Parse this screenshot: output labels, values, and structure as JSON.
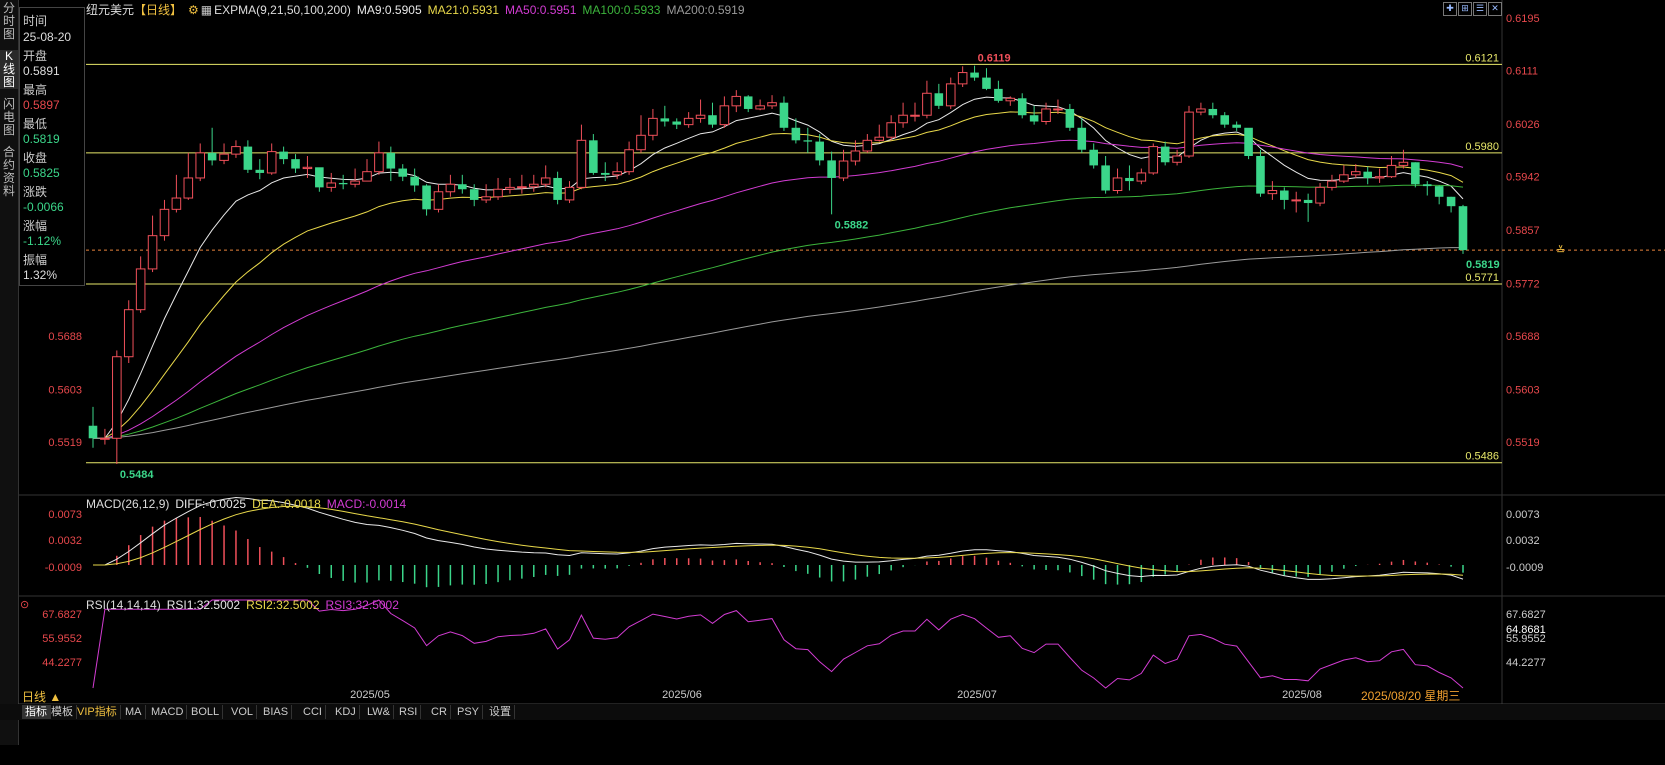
{
  "nav": {
    "items": [
      "分\n时\n图",
      "K\n线\n图",
      "闪\n电\n图",
      "合\n约\n资\n料"
    ],
    "active_index": 1
  },
  "info": {
    "time_label": "时间",
    "time_value": "25-08-20",
    "open_label": "开盘",
    "open_value": "0.5891",
    "high_label": "最高",
    "high_value": "0.5897",
    "low_label": "最低",
    "low_value": "0.5819",
    "close_label": "收盘",
    "close_value": "0.5825",
    "change_label": "涨跌",
    "change_value": "-0.0066",
    "pct_label": "涨幅",
    "pct_value": "-1.12%",
    "amp_label": "振幅",
    "amp_value": "1.32%"
  },
  "title": {
    "symbol": "纽元美元",
    "period": "【日线】",
    "indicator": "EXPMA(9,21,50,100,200)",
    "ma9": "MA9:0.5905",
    "ma21": "MA21:0.5931",
    "ma50": "MA50:0.5951",
    "ma100": "MA100:0.5933",
    "ma200": "MA200:0.5919"
  },
  "colors": {
    "up": "#f0505a",
    "down": "#3bd68a",
    "ma9": "#e8e8e8",
    "ma21": "#e8d84a",
    "ma50": "#d23cd2",
    "ma100": "#3cb43c",
    "ma200": "#9a9a9a",
    "hline": "#e8e86a",
    "axis_red": "#e8484c"
  },
  "main_axis": {
    "ticks": [
      "0.6195",
      "0.6111",
      "0.6026",
      "0.5942",
      "0.5857",
      "0.5772",
      "0.5688",
      "0.5603",
      "0.5519"
    ],
    "left_ticks": [
      "0.5688",
      "0.5603",
      "0.5519"
    ],
    "hlines": [
      "0.6121",
      "0.5980",
      "0.5771",
      "0.5486"
    ],
    "current": "0.5825",
    "high_mark": "0.6119",
    "low_mark": "0.5484",
    "mid_low_mark": "0.5882",
    "last_low_mark": "0.5819"
  },
  "macd": {
    "title": "MACD(26,12,9)",
    "diff": "DIFF:-0.0025",
    "dea": "DEA:-0.0018",
    "macd": "MACD:-0.0014",
    "ticks": [
      "0.0073",
      "0.0032",
      "-0.0009"
    ]
  },
  "rsi": {
    "title": "RSI(14,14,14)",
    "rsi1": "RSI1:32.5002",
    "rsi2": "RSI2:32.5002",
    "rsi3": "RSI3:32.5002",
    "ticks": [
      "67.6827",
      "55.9552",
      "44.2277"
    ],
    "right_ticks": [
      "67.6827",
      "64.8681",
      "55.9552",
      "44.2277"
    ]
  },
  "dates": [
    "2025/05",
    "2025/06",
    "2025/07",
    "2025/08"
  ],
  "date_box": "2025/08/20 星期三",
  "period_button": "日线 ▲",
  "tabs": [
    "指标",
    "模板",
    "VIP指标",
    "MA",
    "MACD",
    "BOLL",
    "VOL",
    "BIAS",
    "CCI",
    "KDJ",
    "LW&",
    "RSI",
    "CR",
    "PSY",
    "设置"
  ],
  "chart_data": {
    "type": "candlestick",
    "title": "纽元美元",
    "ylim": [
      0.5476,
      0.6195
    ],
    "open": [
      0.5545,
      0.5525,
      0.5525,
      0.5655,
      0.573,
      0.5795,
      0.5848,
      0.589,
      0.5908,
      0.594,
      0.598,
      0.5968,
      0.5978,
      0.599,
      0.5953,
      0.5948,
      0.5982,
      0.597,
      0.5955,
      0.5957,
      0.5925,
      0.5932,
      0.593,
      0.5935,
      0.595,
      0.598,
      0.5955,
      0.5942,
      0.5928,
      0.589,
      0.5918,
      0.593,
      0.5922,
      0.5905,
      0.591,
      0.5922,
      0.5925,
      0.5926,
      0.593,
      0.594,
      0.5905,
      0.5925,
      0.6,
      0.5948,
      0.5945,
      0.595,
      0.5985,
      0.6008,
      0.6035,
      0.603,
      0.6025,
      0.6035,
      0.604,
      0.6025,
      0.6055,
      0.607,
      0.605,
      0.6055,
      0.606,
      0.602,
      0.6,
      0.5998,
      0.5968,
      0.594,
      0.5967,
      0.5983,
      0.6,
      0.6005,
      0.6028,
      0.604,
      0.604,
      0.6075,
      0.6055,
      0.609,
      0.6108,
      0.61,
      0.6082,
      0.6063,
      0.6067,
      0.604,
      0.603,
      0.605,
      0.605,
      0.602,
      0.5985,
      0.596,
      0.592,
      0.594,
      0.5935,
      0.5948,
      0.599,
      0.5965,
      0.5975,
      0.6045,
      0.605,
      0.604,
      0.6025,
      0.602,
      0.5975,
      0.5915,
      0.592,
      0.5905,
      0.5905,
      0.59,
      0.5925,
      0.5935,
      0.5945,
      0.595,
      0.594,
      0.5942,
      0.596,
      0.5965,
      0.593,
      0.5927,
      0.591,
      0.5895
    ],
    "close": [
      0.5525,
      0.5525,
      0.5655,
      0.573,
      0.5795,
      0.5848,
      0.589,
      0.5908,
      0.594,
      0.598,
      0.5968,
      0.5978,
      0.599,
      0.5953,
      0.5948,
      0.5982,
      0.597,
      0.5955,
      0.5957,
      0.5925,
      0.5932,
      0.593,
      0.5935,
      0.595,
      0.598,
      0.5955,
      0.5942,
      0.5928,
      0.589,
      0.5918,
      0.593,
      0.5922,
      0.5905,
      0.591,
      0.5922,
      0.5925,
      0.5926,
      0.593,
      0.594,
      0.5905,
      0.5925,
      0.6,
      0.5948,
      0.5945,
      0.595,
      0.5985,
      0.6008,
      0.6035,
      0.603,
      0.6025,
      0.6035,
      0.604,
      0.6025,
      0.6055,
      0.607,
      0.605,
      0.6055,
      0.606,
      0.602,
      0.6,
      0.5998,
      0.5968,
      0.594,
      0.5967,
      0.5983,
      0.6,
      0.6005,
      0.6028,
      0.604,
      0.604,
      0.6075,
      0.6055,
      0.609,
      0.6108,
      0.61,
      0.6082,
      0.6063,
      0.6067,
      0.604,
      0.603,
      0.605,
      0.605,
      0.602,
      0.5985,
      0.596,
      0.592,
      0.594,
      0.5935,
      0.5948,
      0.599,
      0.5965,
      0.5975,
      0.6045,
      0.605,
      0.604,
      0.6025,
      0.602,
      0.5975,
      0.5915,
      0.592,
      0.5905,
      0.5905,
      0.59,
      0.5925,
      0.5935,
      0.5945,
      0.595,
      0.594,
      0.5942,
      0.596,
      0.5965,
      0.593,
      0.5927,
      0.591,
      0.5895,
      0.5825
    ],
    "high": [
      0.5575,
      0.554,
      0.5665,
      0.5745,
      0.5815,
      0.588,
      0.5905,
      0.5945,
      0.598,
      0.5995,
      0.602,
      0.5995,
      0.6,
      0.6,
      0.597,
      0.5995,
      0.599,
      0.5978,
      0.5975,
      0.595,
      0.5948,
      0.5945,
      0.5955,
      0.597,
      0.5998,
      0.599,
      0.5962,
      0.5955,
      0.593,
      0.593,
      0.5945,
      0.5945,
      0.593,
      0.593,
      0.594,
      0.594,
      0.5945,
      0.5945,
      0.596,
      0.595,
      0.5935,
      0.6025,
      0.601,
      0.5965,
      0.5965,
      0.5998,
      0.604,
      0.605,
      0.6055,
      0.6035,
      0.6045,
      0.6065,
      0.606,
      0.607,
      0.608,
      0.6072,
      0.6065,
      0.6072,
      0.607,
      0.6035,
      0.602,
      0.601,
      0.5982,
      0.5985,
      0.6,
      0.601,
      0.6025,
      0.604,
      0.606,
      0.606,
      0.6095,
      0.609,
      0.61,
      0.6118,
      0.6119,
      0.6115,
      0.6095,
      0.607,
      0.6075,
      0.6055,
      0.606,
      0.6065,
      0.6058,
      0.6035,
      0.5995,
      0.5975,
      0.5955,
      0.596,
      0.5955,
      0.5995,
      0.5998,
      0.5985,
      0.6055,
      0.606,
      0.606,
      0.6045,
      0.603,
      0.6018,
      0.5985,
      0.5935,
      0.5925,
      0.5918,
      0.5915,
      0.5932,
      0.5945,
      0.596,
      0.5962,
      0.5958,
      0.5955,
      0.5975,
      0.5985,
      0.5965,
      0.5935,
      0.5928,
      0.591,
      0.5897
    ],
    "low": [
      0.551,
      0.5515,
      0.5484,
      0.5645,
      0.5725,
      0.579,
      0.584,
      0.5885,
      0.5905,
      0.5935,
      0.596,
      0.5962,
      0.5972,
      0.5948,
      0.5938,
      0.5945,
      0.5962,
      0.5948,
      0.594,
      0.5918,
      0.5918,
      0.5922,
      0.5925,
      0.594,
      0.5945,
      0.5935,
      0.5935,
      0.5918,
      0.588,
      0.5885,
      0.591,
      0.5915,
      0.5895,
      0.59,
      0.5905,
      0.5915,
      0.5915,
      0.5918,
      0.5925,
      0.5898,
      0.59,
      0.5922,
      0.5945,
      0.5935,
      0.5938,
      0.5945,
      0.598,
      0.6,
      0.6022,
      0.6018,
      0.602,
      0.6028,
      0.602,
      0.602,
      0.6045,
      0.6045,
      0.6048,
      0.605,
      0.6015,
      0.5995,
      0.598,
      0.596,
      0.5882,
      0.5935,
      0.596,
      0.598,
      0.5998,
      0.6,
      0.602,
      0.603,
      0.6035,
      0.605,
      0.605,
      0.6085,
      0.6095,
      0.608,
      0.606,
      0.6055,
      0.6035,
      0.6025,
      0.6025,
      0.6042,
      0.6015,
      0.598,
      0.5955,
      0.5915,
      0.5915,
      0.592,
      0.593,
      0.5945,
      0.596,
      0.596,
      0.5972,
      0.604,
      0.6035,
      0.602,
      0.6015,
      0.597,
      0.591,
      0.5905,
      0.589,
      0.5885,
      0.587,
      0.5895,
      0.592,
      0.5932,
      0.594,
      0.593,
      0.5932,
      0.594,
      0.5955,
      0.5925,
      0.5912,
      0.5898,
      0.5885,
      0.5819
    ]
  }
}
